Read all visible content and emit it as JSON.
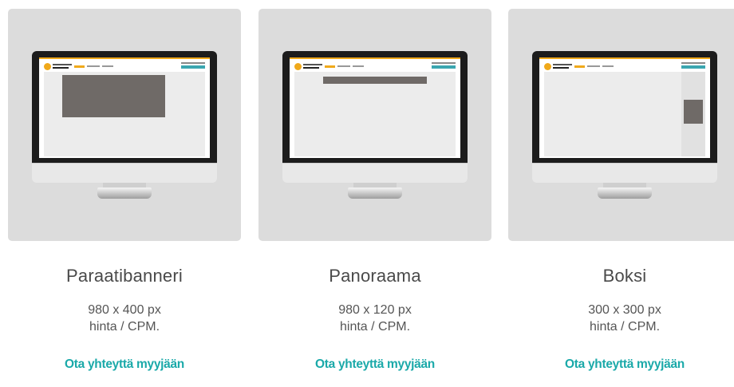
{
  "cards": [
    {
      "title": "Paraatibanneri",
      "size": "980 x 400 px",
      "price": "hinta / CPM.",
      "cta": "Ota yhteyttä myyjään"
    },
    {
      "title": "Panoraama",
      "size": "980 x 120 px",
      "price": "hinta / CPM.",
      "cta": "Ota yhteyttä myyjään"
    },
    {
      "title": "Boksi",
      "size": "300 x 300 px",
      "price": "hinta / CPM.",
      "cta": "Ota yhteyttä myyjään"
    }
  ],
  "colors": {
    "accent": "#1aa9a9",
    "brand_orange": "#f0a91b",
    "ad_placeholder": "#6f6a67"
  }
}
